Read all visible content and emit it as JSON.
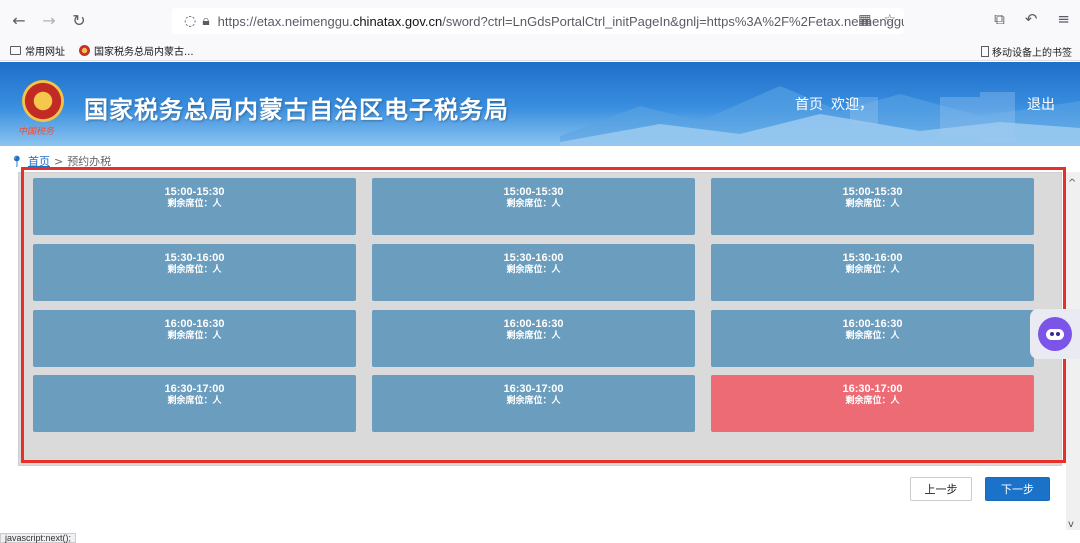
{
  "browser": {
    "url_prefix": "https://etax.neimenggu.",
    "url_domain": "chinatax.gov.cn",
    "url_suffix": "/sword?ctrl=LnGdsPortalCtrl_initPageIn&gnlj=https%3A%2F%2Fetax.neimenggu",
    "bookmarks": [
      "常用网址",
      "国家税务总局内蒙古..."
    ],
    "mobile_bookmarks": "移动设备上的书签",
    "status_text": "javascript:next();"
  },
  "header": {
    "logo_text": "中国税务",
    "title": "国家税务总局内蒙古自治区电子税务局",
    "nav_home": "首页",
    "welcome": "欢迎，",
    "logout": "退出"
  },
  "breadcrumb": {
    "home": "首页",
    "separator": ">",
    "current": "预约办税"
  },
  "slots": [
    {
      "time": "15:00-15:30",
      "seats": "剩余席位：人",
      "state": "available"
    },
    {
      "time": "15:00-15:30",
      "seats": "剩余席位：人",
      "state": "available"
    },
    {
      "time": "15:00-15:30",
      "seats": "剩余席位：人",
      "state": "available"
    },
    {
      "time": "15:30-16:00",
      "seats": "剩余席位：人",
      "state": "available"
    },
    {
      "time": "15:30-16:00",
      "seats": "剩余席位：人",
      "state": "available"
    },
    {
      "time": "15:30-16:00",
      "seats": "剩余席位：人",
      "state": "available"
    },
    {
      "time": "16:00-16:30",
      "seats": "剩余席位：人",
      "state": "available"
    },
    {
      "time": "16:00-16:30",
      "seats": "剩余席位：人",
      "state": "available"
    },
    {
      "time": "16:00-16:30",
      "seats": "剩余席位：人",
      "state": "available"
    },
    {
      "time": "16:30-17:00",
      "seats": "剩余席位：人",
      "state": "available"
    },
    {
      "time": "16:30-17:00",
      "seats": "剩余席位：人",
      "state": "available"
    },
    {
      "time": "16:30-17:00",
      "seats": "剩余席位：人",
      "state": "selected"
    }
  ],
  "buttons": {
    "prev": "上一步",
    "next": "下一步"
  },
  "colors": {
    "slot_available": "#6a9dbe",
    "slot_selected": "#ed6b75",
    "highlight_border": "#e8302a",
    "primary_button": "#1a73c8"
  }
}
